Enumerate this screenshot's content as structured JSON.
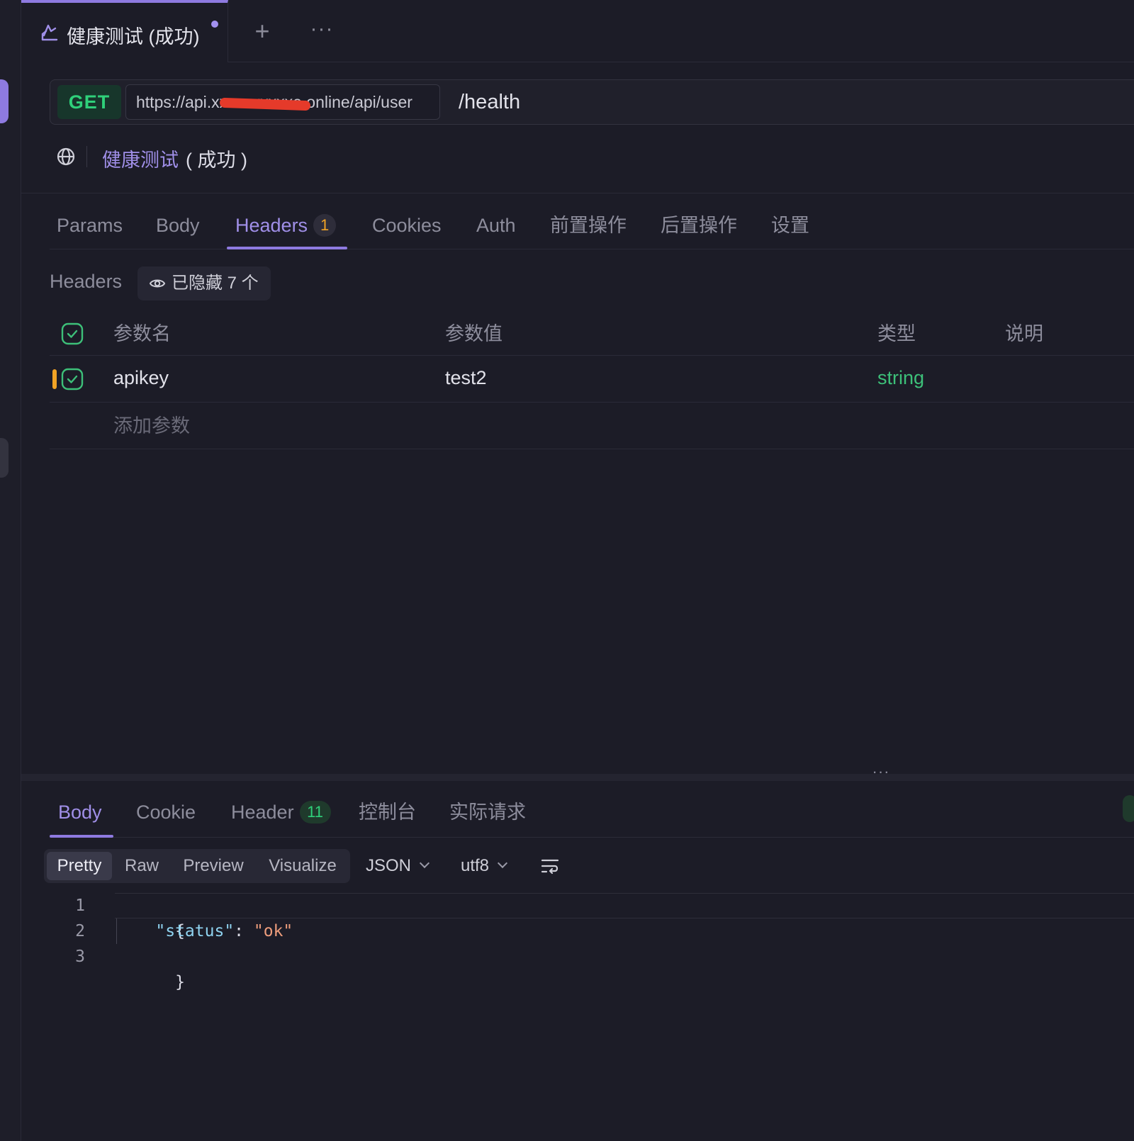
{
  "tab": {
    "title": "健康测试 (成功)",
    "add_symbol": "+",
    "more_symbol": "···",
    "icon": "api-request-icon"
  },
  "request": {
    "method": "GET",
    "base_url": "https://api.xxxxxxxxxxe.online/api/user",
    "path": "/health"
  },
  "environment": {
    "icon": "globe-icon",
    "name": "健康测试",
    "status": "( 成功 )"
  },
  "request_tabs": [
    {
      "label": "Params"
    },
    {
      "label": "Body"
    },
    {
      "label": "Headers",
      "badge": "1",
      "active": true
    },
    {
      "label": "Cookies"
    },
    {
      "label": "Auth"
    },
    {
      "label": "前置操作"
    },
    {
      "label": "后置操作"
    },
    {
      "label": "设置"
    }
  ],
  "headers_section": {
    "label": "Headers",
    "hidden_text": "已隐藏 7 个",
    "columns": [
      "参数名",
      "参数值",
      "类型",
      "说明"
    ],
    "rows": [
      {
        "name": "apikey",
        "value": "test2",
        "type": "string",
        "description": "",
        "enabled": true
      }
    ],
    "add_placeholder": "添加参数"
  },
  "splitter": {
    "symbol": "···"
  },
  "response_tabs": [
    {
      "label": "Body",
      "active": true
    },
    {
      "label": "Cookie"
    },
    {
      "label": "Header",
      "badge": "11"
    },
    {
      "label": "控制台"
    },
    {
      "label": "实际请求"
    }
  ],
  "body_toolbar": {
    "modes": [
      "Pretty",
      "Raw",
      "Preview",
      "Visualize"
    ],
    "active_mode": "Pretty",
    "format": "JSON",
    "encoding": "utf8"
  },
  "code": {
    "line_numbers": [
      "1",
      "2",
      "3"
    ],
    "open_brace": "{",
    "key": "\"status\"",
    "colon": ": ",
    "value": "\"ok\"",
    "close_brace": "}"
  },
  "colors": {
    "accent": "#8e7ae0",
    "method_green": "#2fd07a",
    "badge_orange": "#f1a325",
    "type_green": "#3dc079",
    "background": "#1c1c27"
  }
}
